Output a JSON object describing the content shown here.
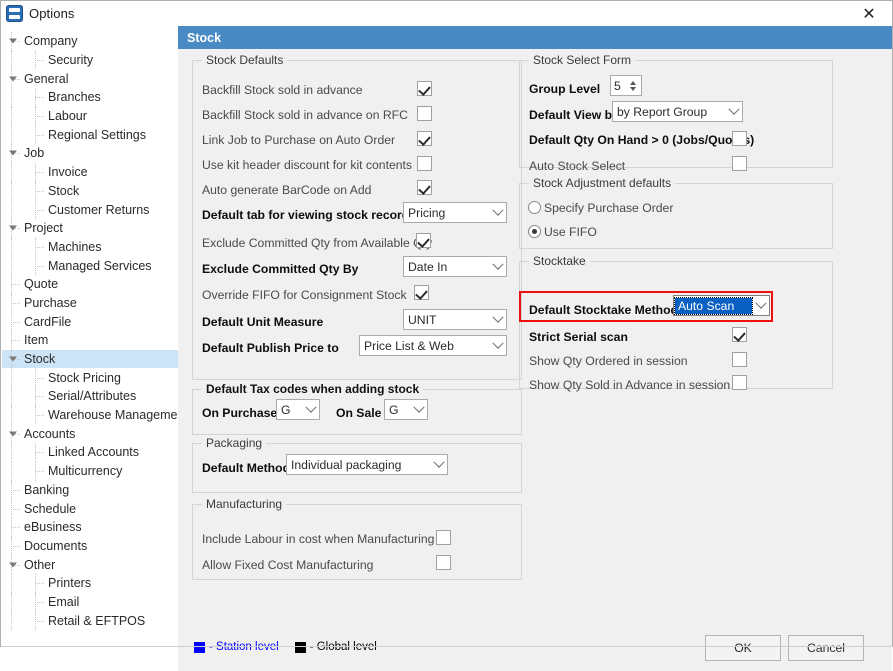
{
  "window": {
    "title": "Options",
    "icon": "app-icon",
    "close_label": "✕"
  },
  "sidebar": {
    "items": [
      {
        "label": "Company",
        "level": 0,
        "expanded": true,
        "selected": false
      },
      {
        "label": "Security",
        "level": 1,
        "expanded": null,
        "selected": false
      },
      {
        "label": "General",
        "level": 0,
        "expanded": true,
        "selected": false
      },
      {
        "label": "Branches",
        "level": 1,
        "expanded": null,
        "selected": false
      },
      {
        "label": "Labour",
        "level": 1,
        "expanded": null,
        "selected": false
      },
      {
        "label": "Regional Settings",
        "level": 1,
        "expanded": null,
        "selected": false
      },
      {
        "label": "Job",
        "level": 0,
        "expanded": true,
        "selected": false
      },
      {
        "label": "Invoice",
        "level": 1,
        "expanded": null,
        "selected": false
      },
      {
        "label": "Stock",
        "level": 1,
        "expanded": null,
        "selected": false
      },
      {
        "label": "Customer Returns",
        "level": 1,
        "expanded": null,
        "selected": false
      },
      {
        "label": "Project",
        "level": 0,
        "expanded": true,
        "selected": false
      },
      {
        "label": "Machines",
        "level": 1,
        "expanded": null,
        "selected": false
      },
      {
        "label": "Managed Services",
        "level": 1,
        "expanded": null,
        "selected": false
      },
      {
        "label": "Quote",
        "level": 0,
        "expanded": false,
        "selected": false
      },
      {
        "label": "Purchase",
        "level": 0,
        "expanded": false,
        "selected": false
      },
      {
        "label": "CardFile",
        "level": 0,
        "expanded": false,
        "selected": false
      },
      {
        "label": "Item",
        "level": 0,
        "expanded": false,
        "selected": false
      },
      {
        "label": "Stock",
        "level": 0,
        "expanded": true,
        "selected": true
      },
      {
        "label": "Stock Pricing",
        "level": 1,
        "expanded": null,
        "selected": false
      },
      {
        "label": "Serial/Attributes",
        "level": 1,
        "expanded": null,
        "selected": false
      },
      {
        "label": "Warehouse Management",
        "level": 1,
        "expanded": null,
        "selected": false
      },
      {
        "label": "Accounts",
        "level": 0,
        "expanded": true,
        "selected": false
      },
      {
        "label": "Linked Accounts",
        "level": 1,
        "expanded": null,
        "selected": false
      },
      {
        "label": "Multicurrency",
        "level": 1,
        "expanded": null,
        "selected": false
      },
      {
        "label": "Banking",
        "level": 0,
        "expanded": false,
        "selected": false
      },
      {
        "label": "Schedule",
        "level": 0,
        "expanded": false,
        "selected": false
      },
      {
        "label": "eBusiness",
        "level": 0,
        "expanded": false,
        "selected": false
      },
      {
        "label": "Documents",
        "level": 0,
        "expanded": false,
        "selected": false
      },
      {
        "label": "Other",
        "level": 0,
        "expanded": true,
        "selected": false
      },
      {
        "label": "Printers",
        "level": 1,
        "expanded": null,
        "selected": false
      },
      {
        "label": "Email",
        "level": 1,
        "expanded": null,
        "selected": false
      },
      {
        "label": "Retail & EFTPOS",
        "level": 1,
        "expanded": null,
        "selected": false
      }
    ]
  },
  "pane": {
    "header_title": "Stock"
  },
  "stock_defaults": {
    "title": "Stock Defaults",
    "backfill_label": "Backfill Stock sold in advance",
    "backfill_checked": true,
    "backfill_rfc_label": "Backfill Stock sold in advance on RFC",
    "backfill_rfc_checked": false,
    "link_job_label": "Link Job to Purchase on Auto Order",
    "link_job_checked": true,
    "kit_header_label": "Use kit header discount for kit contents",
    "kit_header_checked": false,
    "barcode_label": "Auto generate BarCode on Add",
    "barcode_checked": true,
    "default_tab_label": "Default tab for viewing stock record",
    "default_tab_value": "Pricing",
    "exclude_committed_label": "Exclude Committed Qty from Available Qty",
    "exclude_committed_checked": true,
    "exclude_committed_by_label": "Exclude Committed Qty By",
    "exclude_committed_by_value": "Date In",
    "override_fifo_label": "Override FIFO for Consignment Stock",
    "override_fifo_checked": true,
    "unit_measure_label": "Default Unit Measure",
    "unit_measure_value": "UNIT",
    "publish_price_label": "Default Publish Price to",
    "publish_price_value": "Price List & Web"
  },
  "tax_codes": {
    "title": "Default Tax codes when adding stock",
    "on_purchase_label": "On Purchase",
    "on_purchase_value": "G",
    "on_sale_label": "On Sale",
    "on_sale_value": "G"
  },
  "packaging": {
    "title": "Packaging",
    "method_label": "Default Method",
    "method_value": "Individual packaging"
  },
  "manufacturing": {
    "title": "Manufacturing",
    "include_labour_label": "Include Labour in cost when Manufacturing",
    "include_labour_checked": false,
    "fixed_cost_label": "Allow Fixed Cost Manufacturing",
    "fixed_cost_checked": false
  },
  "stock_select_form": {
    "title": "Stock Select Form",
    "group_level_label": "Group Level",
    "group_level_value": "5",
    "default_view_label": "Default View by",
    "default_view_value": "by Report Group",
    "qty_on_hand_label": "Default Qty On Hand > 0 (Jobs/Quotes)",
    "qty_on_hand_checked": false,
    "auto_stock_select_label": "Auto Stock Select",
    "auto_stock_select_checked": false
  },
  "stock_adjustment": {
    "title": "Stock Adjustment defaults",
    "specify_po_label": "Specify Purchase Order",
    "specify_po_selected": false,
    "use_fifo_label": "Use FIFO",
    "use_fifo_selected": true
  },
  "stocktake": {
    "title": "Stocktake",
    "method_label": "Default Stocktake Method",
    "method_value": "Auto Scan",
    "strict_serial_label": "Strict Serial scan",
    "strict_serial_checked": true,
    "qty_ordered_label": "Show Qty Ordered in session",
    "qty_ordered_checked": false,
    "qty_sold_label": "Show Qty Sold in Advance in session",
    "qty_sold_checked": false,
    "highlight_color": "#ee1111"
  },
  "footer": {
    "station_level_label": "- Station level",
    "station_level_color": "#0000ff",
    "global_level_label": "- Global level",
    "global_level_color": "#000000",
    "ok_label": "OK",
    "cancel_label": "Cancel"
  }
}
